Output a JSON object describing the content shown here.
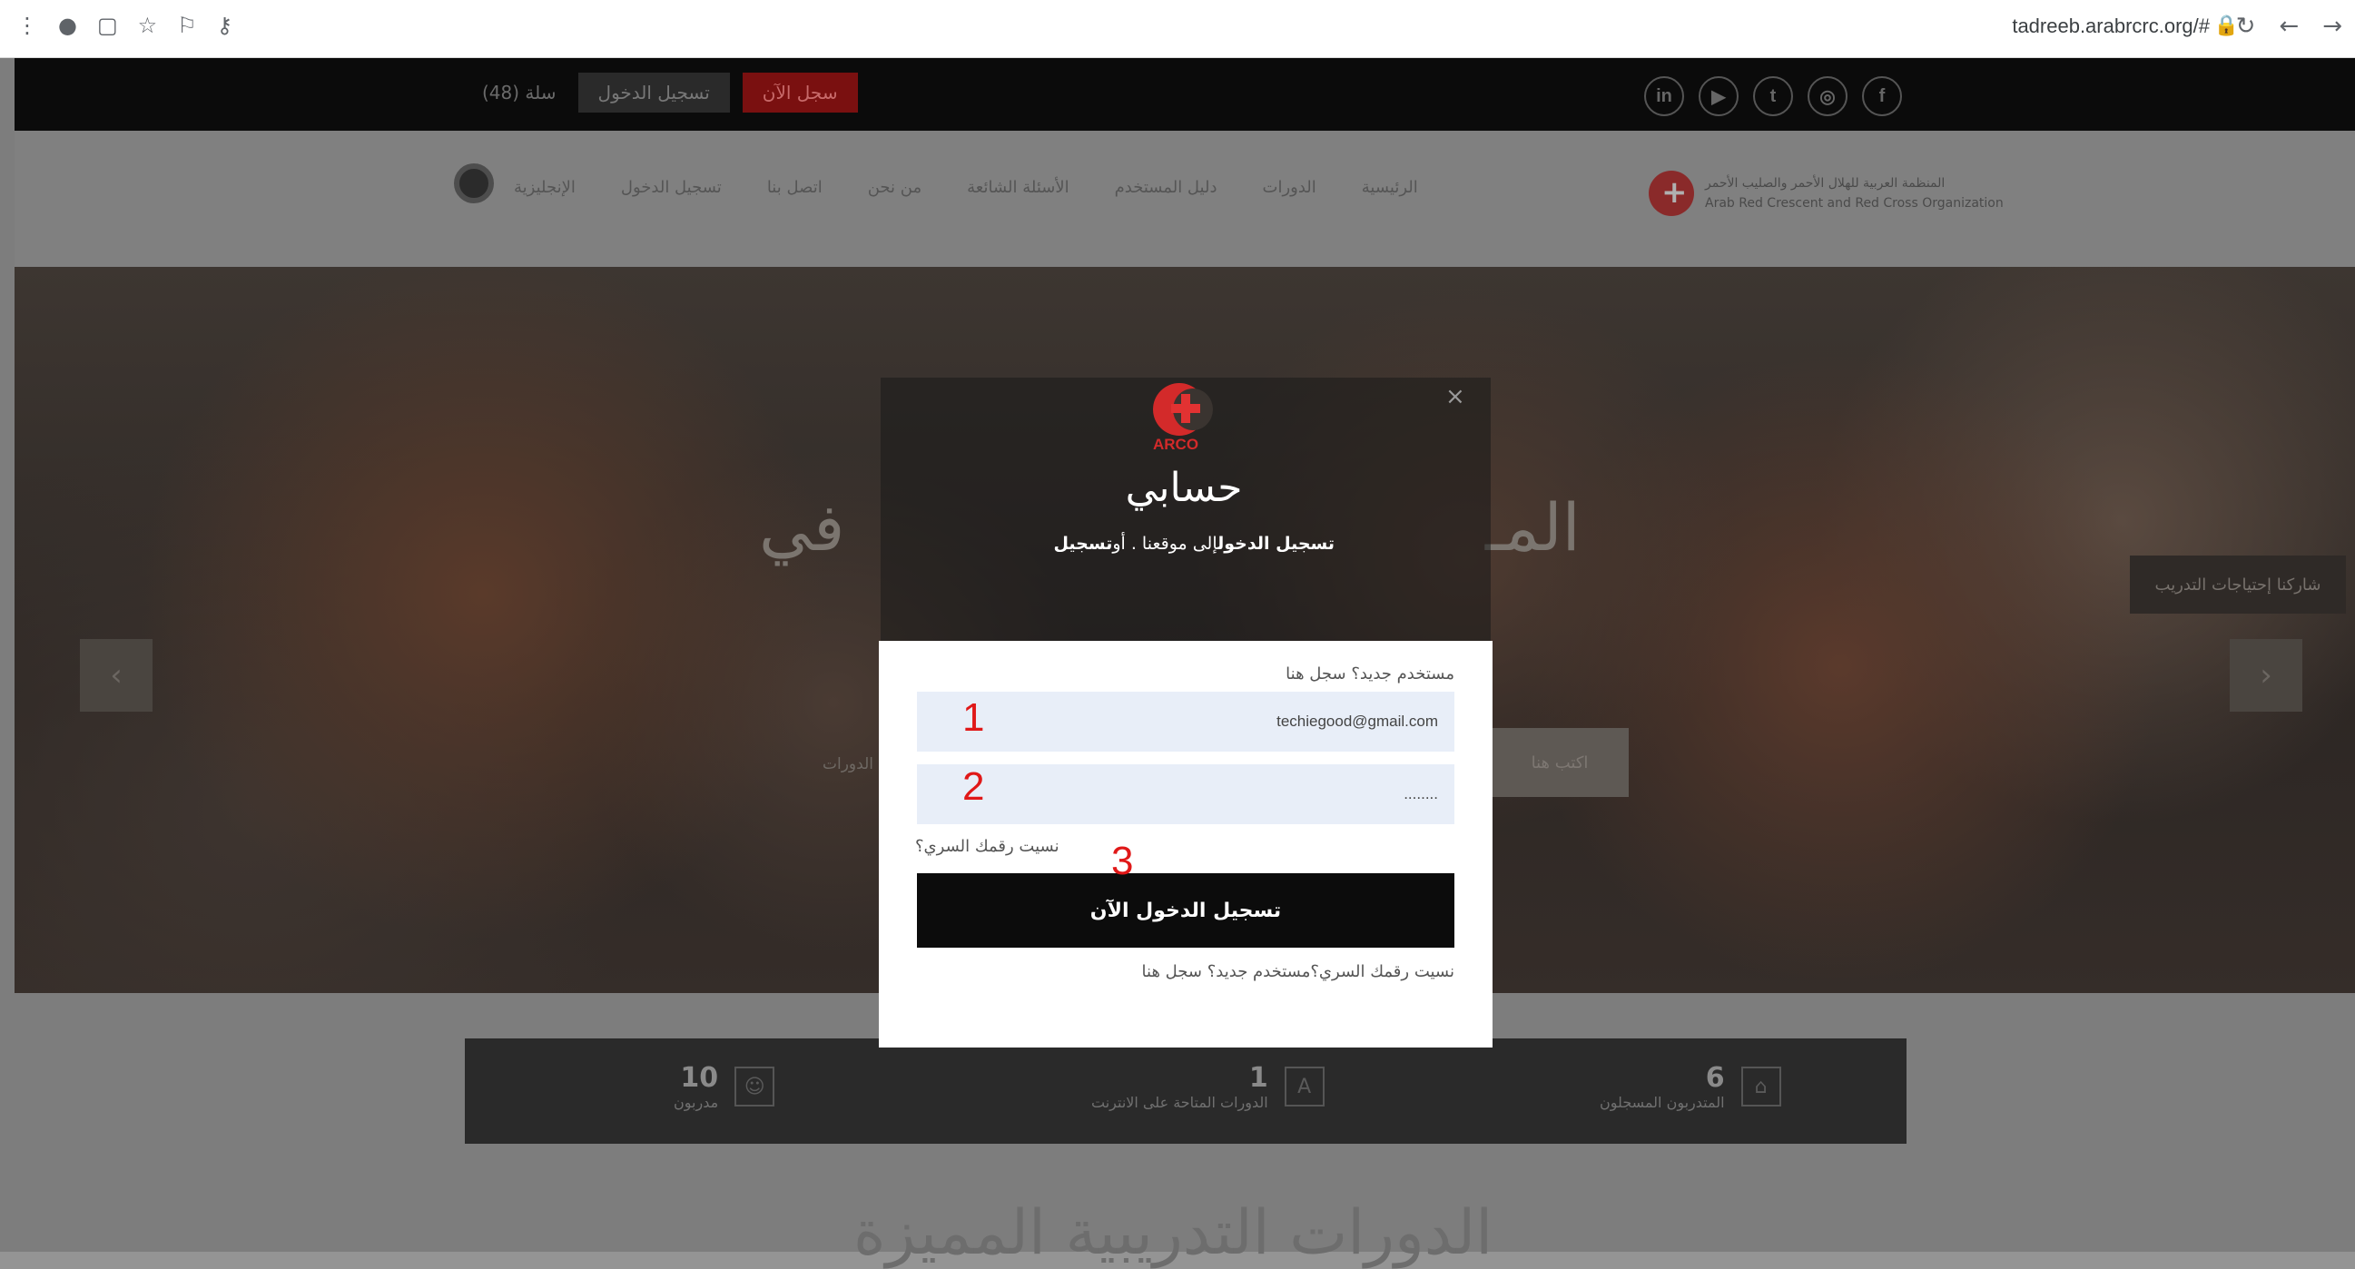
{
  "browser": {
    "url": "tadreeb.arabrcrc.org/#",
    "lock_icon": "lock-icon",
    "toolbar_icons": [
      "menu-icon",
      "profile-icon",
      "tab-icon",
      "star-icon",
      "extension-icon",
      "key-icon"
    ]
  },
  "topbar": {
    "register_now": "سجل الآن",
    "login": "تسجيل الدخول",
    "cart": "(48) سلة",
    "social": [
      "f",
      "◎",
      "t",
      "▶",
      "in"
    ]
  },
  "navbar": {
    "brand_line1": "المنظمة العربية للهلال الأحمر والصليب الأحمر",
    "brand_line2": "Arab Red Crescent and Red Cross Organization",
    "menu": [
      "الرئيسية",
      "الدورات",
      "دليل المستخدم",
      "الأسئلة الشائعة",
      "من نحن",
      "اتصل بنا",
      "تسجيل الدخول",
      "الإنجليزية"
    ]
  },
  "hero": {
    "heading_right": "المـ",
    "heading_left": "في",
    "cta_right": "شاركنا إحتياجات التدريب",
    "cta_mid": "اكتب هنا",
    "courses_link": "الدورات",
    "prev": "‹",
    "next": "›"
  },
  "modal": {
    "logo_text": "ARCO",
    "title": "حسابي",
    "subtitle_bold1": "تسجيل الدخول",
    "subtitle_mid": "إلى موقعنا . أو",
    "subtitle_bold2": "تسجيل",
    "close": "×",
    "new_user_prompt": "مستخدم جديد؟ سجل هنا",
    "email_value": "techiegood@gmail.com",
    "password_value": "........",
    "forgot_password": "نسيت رقمك السري؟",
    "login_button": "تسجيل الدخول الآن",
    "bottom_links": "نسيت رقمك السري؟مستخدم جديد؟ سجل هنا"
  },
  "annotations": {
    "step1": "1",
    "step2": "2",
    "step3": "3",
    "color": "#e01818"
  },
  "stats": [
    {
      "num": "6",
      "label": "المتدربون المسجلون",
      "icon": "graduation-cap-icon"
    },
    {
      "num": "1",
      "label": "الدورات المتاحة على الانترنت",
      "icon": "book-icon"
    },
    {
      "num": "10",
      "label": "مدربون",
      "icon": "user-icon"
    }
  ],
  "section_title": "الدورات التدريبية المميزة"
}
